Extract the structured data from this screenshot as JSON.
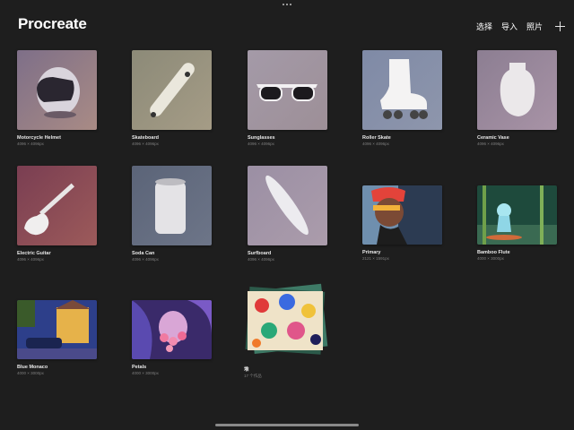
{
  "app": {
    "title": "Procreate"
  },
  "header": {
    "select": "选择",
    "import": "导入",
    "photo": "照片"
  },
  "gallery": [
    {
      "title": "Motorcycle Helmet",
      "sub": "4096 × 4096px"
    },
    {
      "title": "Skateboard",
      "sub": "4096 × 4096px"
    },
    {
      "title": "Sunglasses",
      "sub": "4096 × 4096px"
    },
    {
      "title": "Roller Skate",
      "sub": "4096 × 4096px"
    },
    {
      "title": "Ceramic Vase",
      "sub": "4096 × 4096px"
    },
    {
      "title": "Electric Guitar",
      "sub": "4096 × 4096px"
    },
    {
      "title": "Soda Can",
      "sub": "4096 × 4096px"
    },
    {
      "title": "Surfboard",
      "sub": "4096 × 4096px"
    },
    {
      "title": "Primary",
      "sub": "2121 × 1591px"
    },
    {
      "title": "Bamboo Flute",
      "sub": "4000 × 3000px"
    },
    {
      "title": "Blue Monaco",
      "sub": "4000 × 3000px"
    },
    {
      "title": "Petals",
      "sub": "4000 × 3000px"
    },
    {
      "title": "堆",
      "sub": "17 个作品"
    }
  ]
}
